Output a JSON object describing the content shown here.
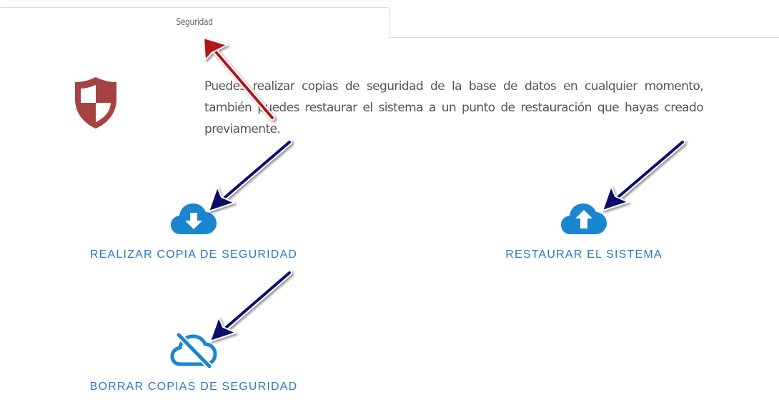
{
  "tabs": [
    {
      "label": "Seguridad",
      "active": true
    }
  ],
  "section": {
    "icon": "shield-icon",
    "description": "Puedes realizar copias de seguridad de la base de datos en cualquier momento, también puedes restaurar el sistema a un punto de restauración que hayas creado previamente."
  },
  "actions": {
    "backup": {
      "label": "REALIZAR COPIA DE SEGURIDAD",
      "icon": "cloud-download-icon"
    },
    "restore": {
      "label": "RESTAURAR EL SISTEMA",
      "icon": "cloud-upload-icon"
    },
    "delete": {
      "label": "BORRAR COPIAS DE SEGURIDAD",
      "icon": "cloud-off-icon"
    }
  },
  "colors": {
    "accent": "#2b78c2",
    "icon_blue": "#1a86d0",
    "shield_red": "#a64342",
    "annotation_red": "#b0131c",
    "annotation_navy": "#0d0d6b"
  }
}
